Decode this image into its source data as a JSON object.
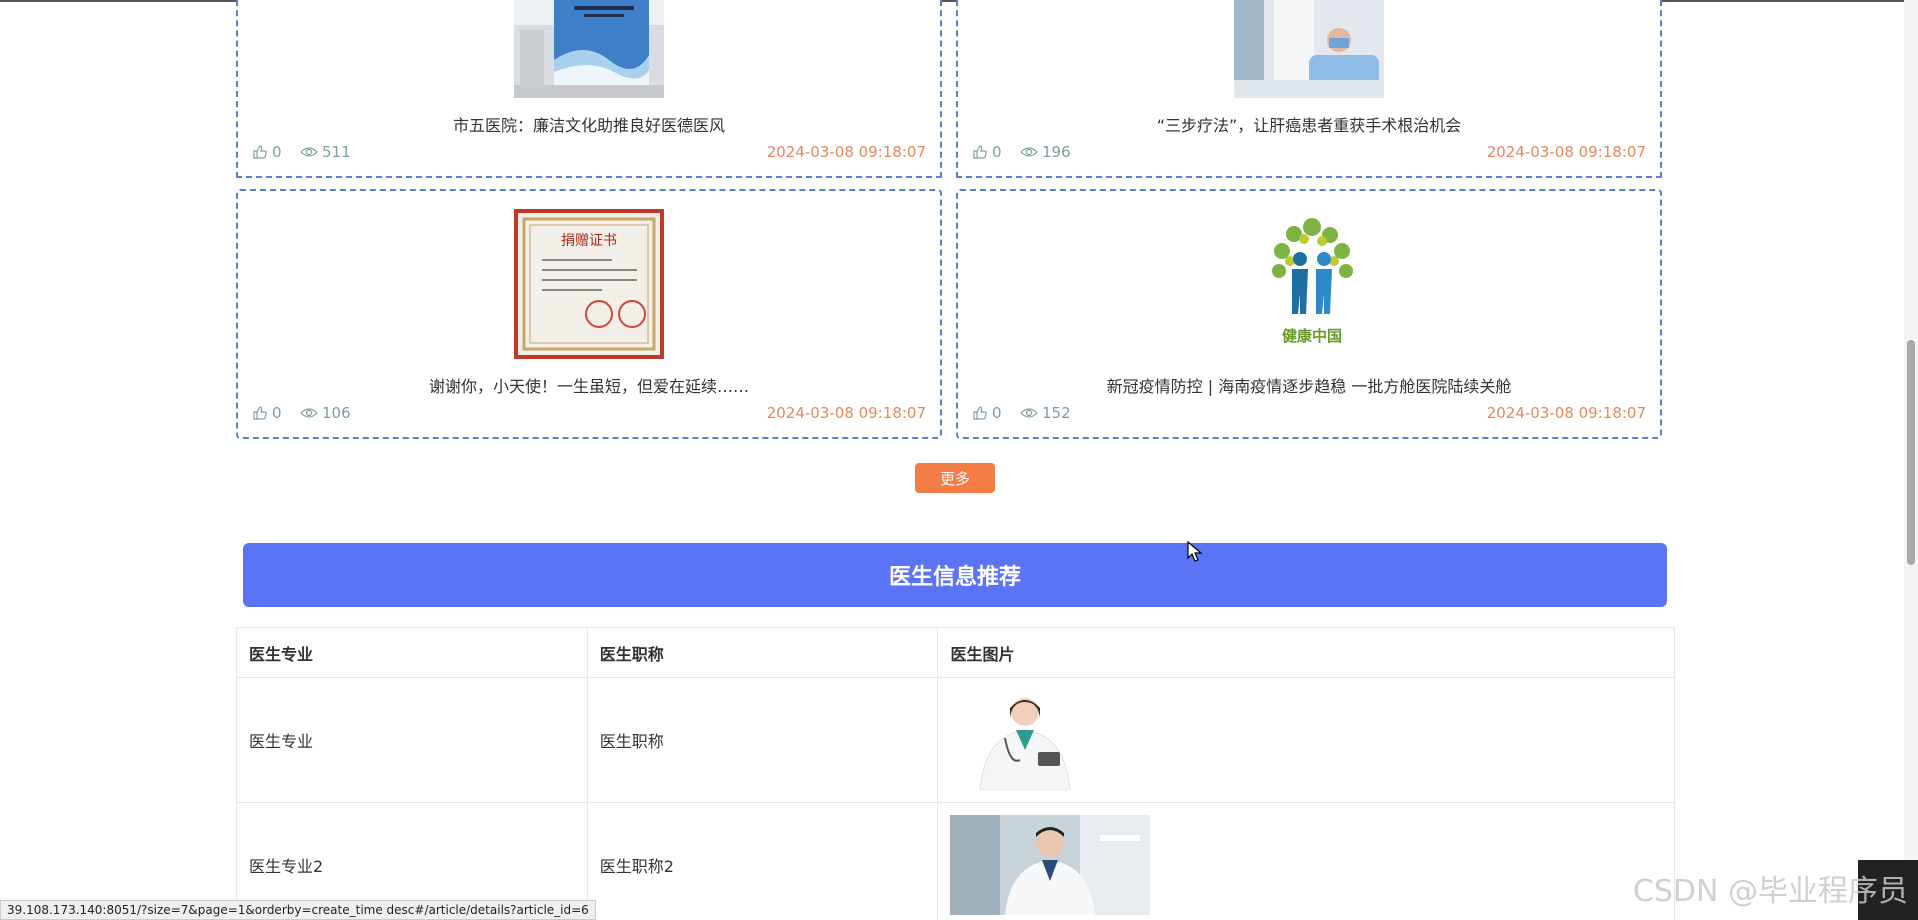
{
  "news": [
    {
      "title": "市五医院：廉洁文化助推良好医德医风",
      "likes": "0",
      "views": "511",
      "date": "2024-03-08 09:18:07"
    },
    {
      "title": "“三步疗法”，让肝癌患者重获手术根治机会",
      "likes": "0",
      "views": "196",
      "date": "2024-03-08 09:18:07"
    },
    {
      "title": "谢谢你，小天使！一生虽短，但爱在延续……",
      "likes": "0",
      "views": "106",
      "date": "2024-03-08 09:18:07"
    },
    {
      "title": "新冠疫情防控 | 海南疫情逐步趋稳 一批方舱医院陆续关舱",
      "likes": "0",
      "views": "152",
      "date": "2024-03-08 09:18:07"
    }
  ],
  "certificate_heading": "捐赠证书",
  "logo_text": "健康中国",
  "more_label": "更多",
  "doctor_section_title": "医生信息推荐",
  "doctor_table": {
    "headers": [
      "医生专业",
      "医生职称",
      "医生图片"
    ],
    "rows": [
      {
        "specialty": "医生专业",
        "title": "医生职称"
      },
      {
        "specialty": "医生专业2",
        "title": "医生职称2"
      }
    ]
  },
  "status_url": "39.108.173.140:8051/?size=7&page=1&orderby=create_time desc#/article/details?article_id=6",
  "watermark": "CSDN @毕业程序员",
  "colors": {
    "accent": "#5b73f5",
    "more_button": "#f47c45",
    "date": "#e9875a",
    "meta": "#7aa48f",
    "card_border": "#5a7fd6"
  }
}
